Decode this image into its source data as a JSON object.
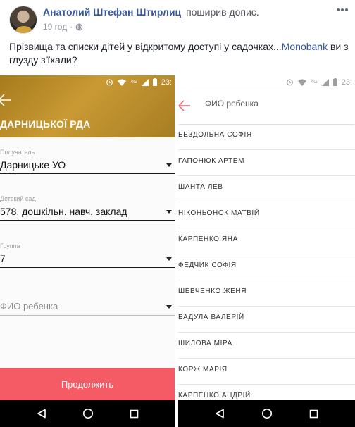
{
  "post": {
    "author": "Анатолий Штефан Штирлиц",
    "action": "поширив допис.",
    "time": "19 год",
    "separator": "·",
    "text_before_link": "Прізвища та списки дітей у відкритому доступі у садочках...",
    "link_text": "Monobank",
    "text_after_link": " ви з глузду з'їхали?",
    "icons": [
      "globe-icon",
      "more-icon"
    ]
  },
  "left_screen": {
    "status_time": "23:",
    "status_network": "4G",
    "org_title": "ДАРНИЦЬКОЇ РДА",
    "accent_color": "#b58a2c",
    "button_color": "#f45b64",
    "fields": [
      {
        "label": "Получатель",
        "value": "Дарницьке УО"
      },
      {
        "label": "Детский сад",
        "value": "578, дошкільн. навч. заклад"
      },
      {
        "label": "Группа",
        "value": "7"
      },
      {
        "label": "",
        "placeholder": "ФИО ребенка"
      }
    ],
    "continue_label": "Продолжить"
  },
  "right_screen": {
    "status_time": "23:",
    "status_network": "4G",
    "title": "ФИО ребенка",
    "accent_color": "#f45b64",
    "children": [
      "БЕЗДОЛЬНА СОФІЯ",
      "ГАПОНЮК АРТЕМ",
      "ШАНТА ЛЕВ",
      "НІКОНЬОНОК МАТВІЙ",
      "КАРПЕНКО ЯНА",
      "ФЕДЧИК СОФІЯ",
      "ШЕВЧЕНКО ЖЕНЯ",
      "БАДУЛА ВАЛЕРІЙ",
      "ШИЛОВА МІРА",
      "КОРЖ МАРІЯ",
      "КАРПЕНКО АНДРІЙ"
    ]
  },
  "nav_icons": [
    "back-triangle-icon",
    "home-circle-icon",
    "recents-square-icon"
  ]
}
